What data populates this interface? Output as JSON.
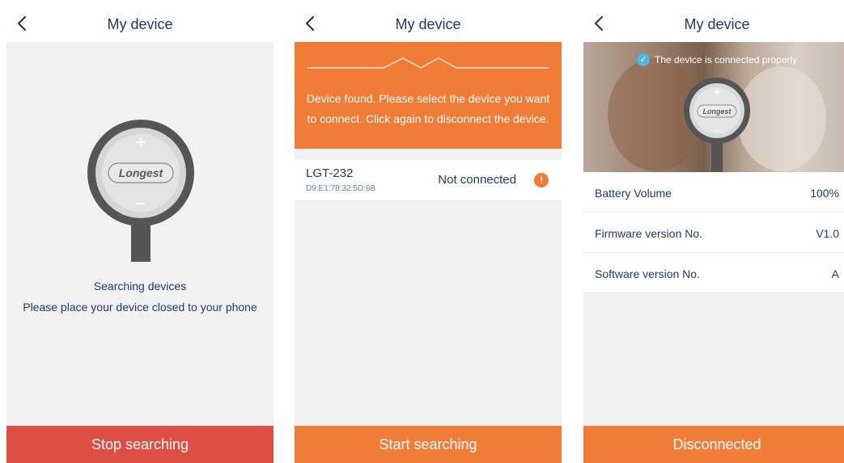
{
  "screens": [
    {
      "title": "My device",
      "status": "Searching devices",
      "hint": "Please place your device closed to your phone",
      "device_logo": "Longest",
      "button": "Stop searching"
    },
    {
      "title": "My device",
      "banner_message": "Device found. Please select the device you want to connect. Click again to disconnect the device.",
      "devices": [
        {
          "name": "LGT-232",
          "mac": "D9:E1:78:32:5D:6B",
          "state": "Not connected",
          "info_icon": "!"
        }
      ],
      "button": "Start searching"
    },
    {
      "title": "My device",
      "connected_message": "The device is connected properly",
      "check_icon": "✓",
      "device_logo": "Longest",
      "info": [
        {
          "label": "Battery Volume",
          "value": "100%"
        },
        {
          "label": "Firmware version No.",
          "value": "V1.0"
        },
        {
          "label": "Software version No.",
          "value": "A"
        }
      ],
      "button": "Disconnected"
    }
  ],
  "colors": {
    "accent_orange": "#f07c37",
    "stop_red": "#de4e45",
    "text_navy": "#1f3b64",
    "background": "#f2f2f2",
    "check_blue": "#4fb7e6"
  }
}
